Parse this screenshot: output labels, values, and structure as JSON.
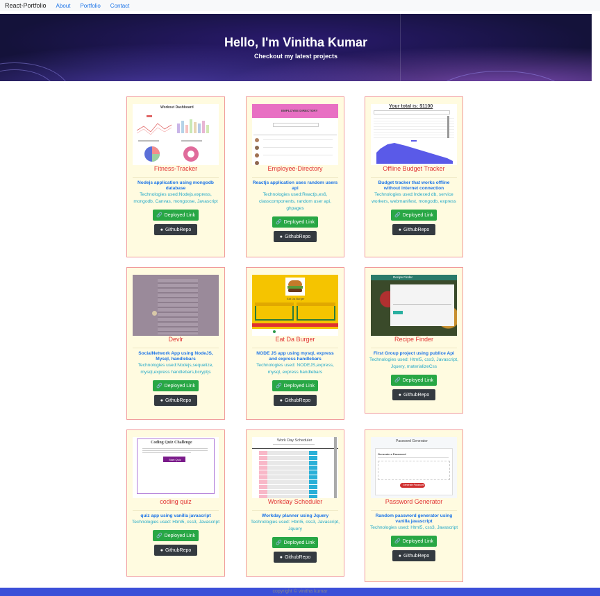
{
  "navbar": {
    "brand": "React-Portfolio",
    "links": [
      "About",
      "Portfolio",
      "Contact"
    ]
  },
  "hero": {
    "title": "Hello, I'm Vinitha Kumar",
    "subtitle": "Checkout my latest projects"
  },
  "projects": [
    {
      "title": "Fitness-Tracker",
      "description": "Nodejs application using mongodb database",
      "technologies": "Technologies used:Nodejs,express, mongodb, Canvas, mongoose, Javascript",
      "deployed_label": "Deployed Link",
      "repo_label": "GithubRepo"
    },
    {
      "title": "Employee-Directory",
      "description": "Reactjs application uses random users api",
      "technologies": "Technologies used:Reactjs,es6, classcomponents, random user api, ghpages",
      "deployed_label": "Deployed Link",
      "repo_label": "GithubRepo"
    },
    {
      "title": "Offline Budget Tracker",
      "description": "Budget tracker that works offline without internet connection",
      "technologies": "Technologies used:Indexed db, service workers, webmanifest, mongodb, express",
      "deployed_label": "Deployed Link",
      "repo_label": "GithubRepo"
    },
    {
      "title": "Devlr",
      "description": "SocialNetwork App using NodeJS, Mysql, handlebars",
      "technologies": "Technologies used:Nodejs,sequelize, mysql,express handlebars,bcryptjs",
      "deployed_label": "Deployed Link",
      "repo_label": "GithubRepo"
    },
    {
      "title": "Eat Da Burger",
      "description": "NODE JS app using mysql, express and express handlebars",
      "technologies": "Technologies used: NODEJS,express, mysql, express handlebars",
      "deployed_label": "Deployed Link",
      "repo_label": "GithubRepo"
    },
    {
      "title": "Recipe Finder",
      "description": "First Group project using publice Api",
      "technologies": "Technologies used: Html5, css3, Javascript, Jquery, materializeCss",
      "deployed_label": "Deployed Link",
      "repo_label": "GithubRepo"
    },
    {
      "title": "coding quiz",
      "description": "quiz app using vanilla javascript",
      "technologies": "Technologies used: Html5, css3, Javascript",
      "deployed_label": "Deployed Link",
      "repo_label": "GithubRepo"
    },
    {
      "title": "Workday Scheduler",
      "description": "Workday planner using Jquery",
      "technologies": "Technologies used: Html5, css3, Javascript, Jquery",
      "deployed_label": "Deployed Link",
      "repo_label": "GithubRepo"
    },
    {
      "title": "Password Generator",
      "description": "Random password generator using vanilla javascript",
      "technologies": "Technologies used: Html5, css3, Javascript",
      "deployed_label": "Deployed Link",
      "repo_label": "GithubRepo"
    }
  ],
  "screenshot_text": {
    "workout": "Workout Dashboard",
    "employee": "EMPLOYEE DIRECTORY",
    "budget": "Your total is: $1100",
    "burger": "Eat Da Burger",
    "recipe": "Recipe Finder",
    "quiz": "Coding Quiz Challenge",
    "quiz_btn": "Start Quiz",
    "scheduler": "Work Day Scheduler",
    "password": "Password Generator",
    "password_sub": "Generate a Password",
    "password_btn": "Generate Password"
  },
  "footer": {
    "text": "copyright © vinitha kumar"
  }
}
